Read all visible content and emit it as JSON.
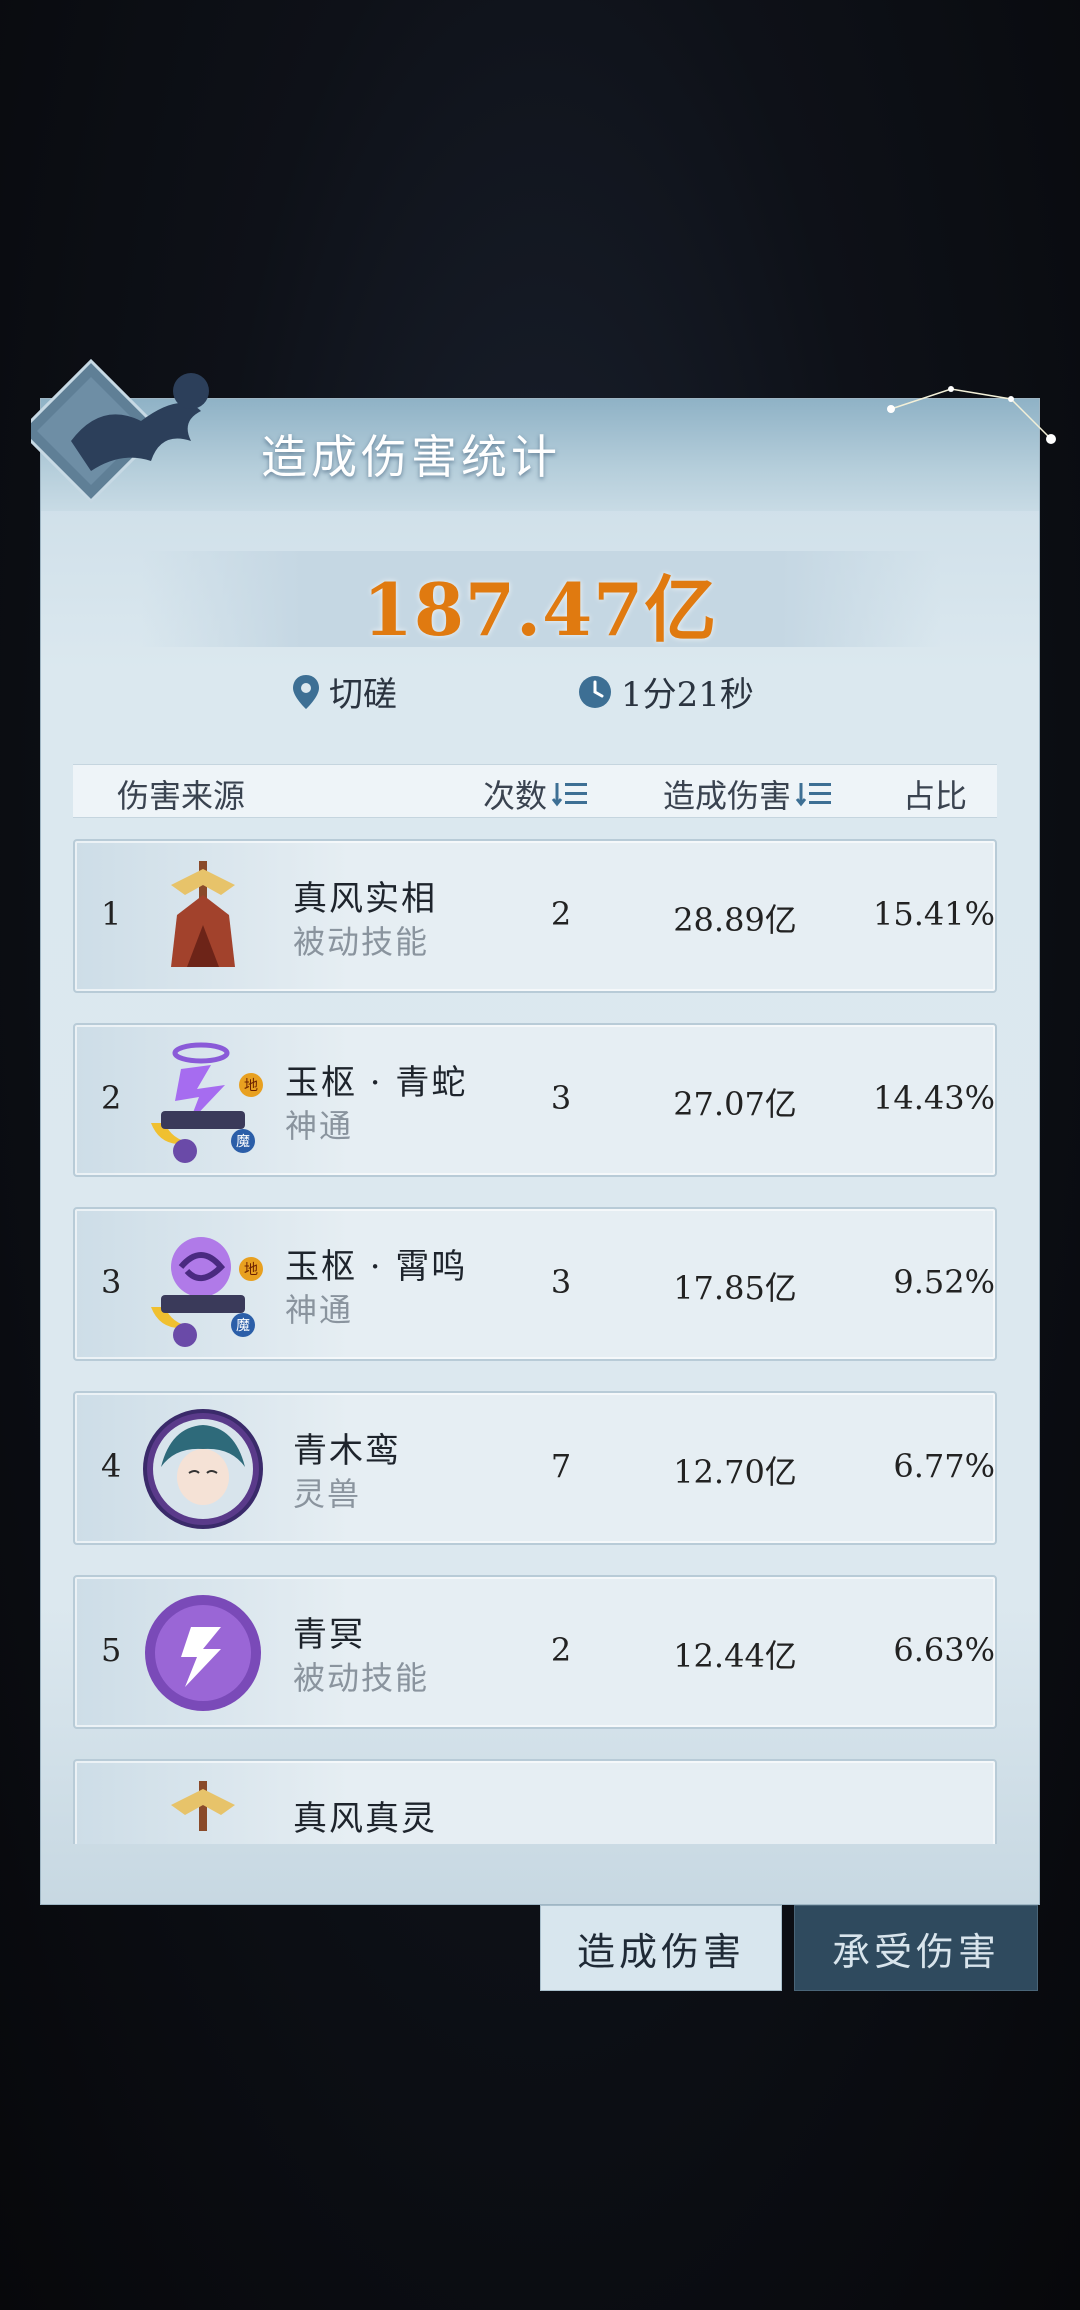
{
  "panel": {
    "title": "造成伤害统计",
    "total": "187.47亿",
    "location": "切磋",
    "duration": "1分21秒"
  },
  "table": {
    "headers": {
      "source": "伤害来源",
      "count": "次数",
      "damage": "造成伤害",
      "ratio": "占比"
    },
    "rows": [
      {
        "rank": "1",
        "name": "真风实相",
        "type": "被动技能",
        "count": "2",
        "damage": "28.89亿",
        "ratio": "15.41%"
      },
      {
        "rank": "2",
        "name": "玉枢 · 青蛇",
        "type": "神通",
        "count": "3",
        "damage": "27.07亿",
        "ratio": "14.43%"
      },
      {
        "rank": "3",
        "name": "玉枢 · 霄鸣",
        "type": "神通",
        "count": "3",
        "damage": "17.85亿",
        "ratio": "9.52%"
      },
      {
        "rank": "4",
        "name": "青木鸾",
        "type": "灵兽",
        "count": "7",
        "damage": "12.70亿",
        "ratio": "6.77%"
      },
      {
        "rank": "5",
        "name": "青冥",
        "type": "被动技能",
        "count": "2",
        "damage": "12.44亿",
        "ratio": "6.63%"
      },
      {
        "rank": "",
        "name": "真风真灵",
        "type": "",
        "count": "",
        "damage": "",
        "ratio": ""
      }
    ]
  },
  "badges": {
    "earth": "地",
    "demon": "魔"
  },
  "tabs": {
    "dealt": "造成伤害",
    "taken": "承受伤害"
  },
  "colors": {
    "accent": "#e07a10",
    "tab_active": "#d8e6ee",
    "tab_inactive": "#2f4a5e"
  }
}
